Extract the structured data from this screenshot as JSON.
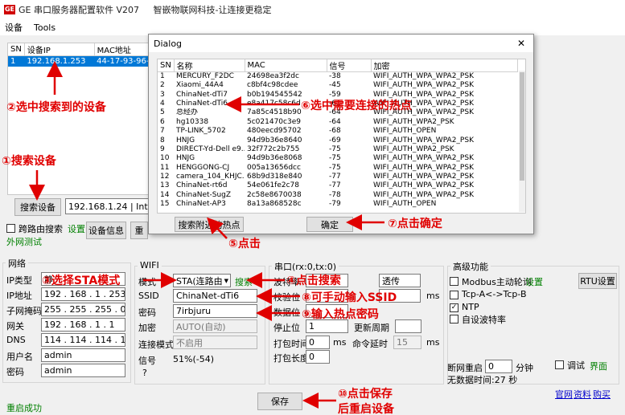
{
  "window": {
    "logo": "GE",
    "title": "GE 串口服务器配置软件 V207     智嵌物联网科技-让连接更稳定"
  },
  "menu": [
    "设备",
    "Tools"
  ],
  "device_table": {
    "headers": [
      "SN",
      "设备IP",
      "MAC地址"
    ],
    "rows": [
      [
        "1",
        "192.168.1.253",
        "44-17-93-96-"
      ]
    ]
  },
  "search_button": "搜索设备",
  "local_ip_value": "192.168.1.24 | Intel(R",
  "cross_subnet_label": "跨路由搜索",
  "settings_link": "设置",
  "extranet_test": "外网测试",
  "device_info_button": "设备信息",
  "restart_button_partial": "重",
  "network": {
    "title": "网络",
    "rows": [
      {
        "label": "IP类型",
        "value": "静"
      },
      {
        "label": "IP地址",
        "value": "192 . 168 . 1 . 253"
      },
      {
        "label": "子网掩码",
        "value": "255 . 255 . 255 . 0"
      },
      {
        "label": "网关",
        "value": "192 . 168 . 1 . 1"
      },
      {
        "label": "DNS",
        "value": "114 . 114 . 114 . 114"
      },
      {
        "label": "用户名",
        "value": "admin"
      },
      {
        "label": "密码",
        "value": "admin"
      }
    ]
  },
  "wifi": {
    "title": "WIFI",
    "mode_label": "模式",
    "mode_value": "STA(连路由",
    "search_link": "搜索",
    "ssid_label": "SSID",
    "ssid_value": "ChinaNet-dTi6",
    "password_label": "密码",
    "password_value": "7irbjuru",
    "encrypt_label": "加密",
    "encrypt_value": "AUTO(自动)",
    "connect_mode_label": "连接模式",
    "connect_mode_value": "不启用",
    "signal_label": "信号",
    "signal_value": "51%(-54)",
    "help": "?"
  },
  "serial": {
    "title": "串口(rx:0,tx:0)",
    "baud_label": "波特率",
    "flow_value": "透传",
    "parity_label": "校验位",
    "databits_label": "数据位",
    "stopbits_label": "停止位",
    "stopbits_value": "1",
    "update_cycle_label": "更新周期",
    "ms1": "ms",
    "ms2": "ms",
    "ms3": "ms",
    "pack_time_label": "打包时间",
    "pack_time_value": "0",
    "cmd_delay_label": "命令延时",
    "cmd_delay_value": "15",
    "pack_len_label": "打包长度",
    "pack_len_value": "0"
  },
  "advanced": {
    "title": "高级功能",
    "modbus_label": "Modbus主动轮询",
    "modbus_setting": "设置",
    "rtu_button": "RTU设置",
    "tcp_label": "Tcp-A<->Tcp-B",
    "ntp_label": "NTP",
    "ntp_check": "✓",
    "baud_adapt_label": "自设波特率",
    "reboot_label": "断网重启",
    "reboot_value": "0",
    "minute_label": "分钟",
    "debug_label": "调试",
    "ui_link": "界面",
    "no_data_time": "无数据时间:27 秒"
  },
  "save_button": "保存",
  "status_text": "重启成功",
  "footer_links": [
    "官网",
    "资料",
    "购买"
  ],
  "dialog": {
    "title": "Dialog",
    "close": "✕",
    "headers": [
      "SN",
      "名称",
      "MAC",
      "信号",
      "加密"
    ],
    "rows": [
      [
        "1",
        "MERCURY_F2DC",
        "24698ea3f2dc",
        "-38",
        "WIFI_AUTH_WPA_WPA2_PSK"
      ],
      [
        "2",
        "Xiaomi_44A4",
        "c8bf4c98cdee",
        "-45",
        "WIFI_AUTH_WPA_WPA2_PSK"
      ],
      [
        "3",
        "ChinaNet-dTi7",
        "b0b194545542",
        "-59",
        "WIFI_AUTH_WPA_WPA2_PSK"
      ],
      [
        "4",
        "ChinaNet-dTi6",
        "e8a417c58c6d",
        "-61",
        "WIFI_AUTH_WPA_WPA2_PSK"
      ],
      [
        "5",
        "总经办",
        "7a85c4518b90",
        "-64",
        "WIFI_AUTH_WPA_WPA2_PSK"
      ],
      [
        "6",
        "hg10338",
        "5c021470c3e9",
        "-64",
        "WIFI_AUTH_WPA2_PSK"
      ],
      [
        "7",
        "TP-LINK_5702",
        "480eecd95702",
        "-68",
        "WIFI_AUTH_OPEN"
      ],
      [
        "8",
        "HNJG",
        "94d9b36e8640",
        "-69",
        "WIFI_AUTH_WPA_WPA2_PSK"
      ],
      [
        "9",
        "DIRECT-Yd-Dell e9...",
        "32f772c2b755",
        "-75",
        "WIFI_AUTH_WPA2_PSK"
      ],
      [
        "10",
        "HNJG",
        "94d9b36e8068",
        "-75",
        "WIFI_AUTH_WPA_WPA2_PSK"
      ],
      [
        "11",
        "HENGGONG-CJ",
        "005a13656dcc",
        "-75",
        "WIFI_AUTH_WPA_WPA2_PSK"
      ],
      [
        "12",
        "camera_104_KHJC...",
        "68b9d318e840",
        "-77",
        "WIFI_AUTH_WPA_WPA2_PSK"
      ],
      [
        "13",
        "ChinaNet-rt6d",
        "54e061fe2c78",
        "-77",
        "WIFI_AUTH_WPA_WPA2_PSK"
      ],
      [
        "14",
        "ChinaNet-SugZ",
        "2c58e8670038",
        "-78",
        "WIFI_AUTH_WPA_WPA2_PSK"
      ],
      [
        "15",
        "ChinaNet-AP3",
        "8a13a868528c",
        "-79",
        "WIFI_AUTH_OPEN"
      ]
    ],
    "search_nearby_button": "搜索附近的热点",
    "ok_button": "确定"
  },
  "annotations": {
    "a1": "①搜索设备",
    "a2": "②选中搜索到的设备",
    "a3": "③选择STA模式",
    "a4": "④点击搜索",
    "a5": "⑤点击",
    "a6": "⑥选中需要连接的热点",
    "a7": "⑦点击确定",
    "a8": "⑧可手动输入SSID",
    "a9": "⑨输入热点密码",
    "a10_line1": "⑩点击保存",
    "a10_line2": "后重启设备"
  },
  "colors": {
    "annotation": "#e00000",
    "selection": "#0078d7",
    "link_green": "#008000"
  }
}
